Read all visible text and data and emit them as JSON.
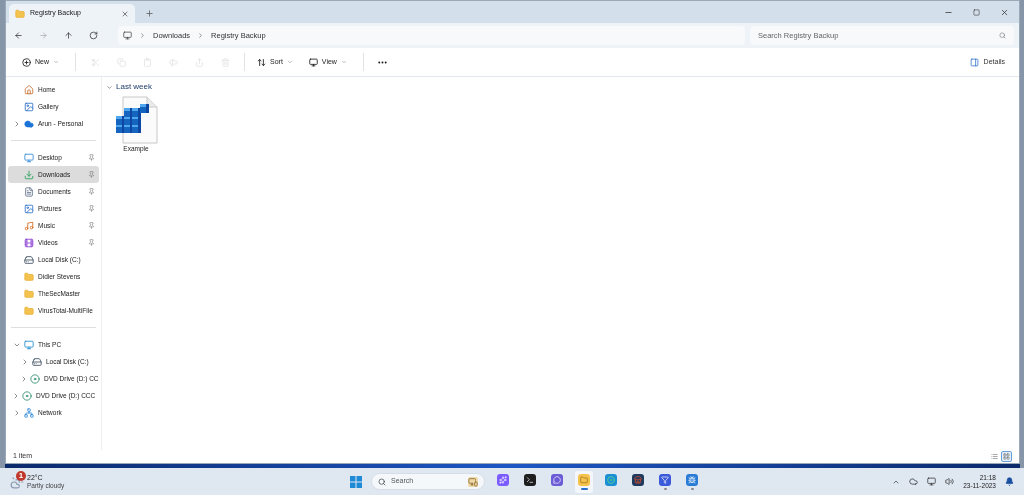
{
  "window": {
    "tabs": [
      {
        "label": "Registry Backup",
        "selected": true
      }
    ]
  },
  "address_bar": {
    "breadcrumb": [
      "Downloads",
      "Registry Backup"
    ],
    "search": {
      "placeholder": "Search Registry Backup"
    }
  },
  "toolbar": {
    "items": [
      {
        "kind": "new",
        "label": "New",
        "disabled": false,
        "dropdown": true
      },
      {
        "kind": "separator"
      },
      {
        "kind": "cut",
        "disabled": true
      },
      {
        "kind": "copy",
        "disabled": true
      },
      {
        "kind": "paste",
        "disabled": true
      },
      {
        "kind": "rename",
        "disabled": true
      },
      {
        "kind": "share",
        "disabled": true
      },
      {
        "kind": "delete",
        "disabled": true
      },
      {
        "kind": "separator"
      },
      {
        "kind": "sort",
        "label": "Sort",
        "disabled": false,
        "dropdown": true
      },
      {
        "kind": "view",
        "label": "View",
        "disabled": false,
        "dropdown": true
      },
      {
        "kind": "separator"
      },
      {
        "kind": "more",
        "disabled": false
      }
    ],
    "details": {
      "label": "Details"
    }
  },
  "sidebar": {
    "sections": [
      {
        "items": [
          {
            "label": "Home",
            "kind": "home",
            "selected": false
          },
          {
            "label": "Gallery",
            "kind": "gallery",
            "selected": false
          },
          {
            "label": "Arun - Personal",
            "kind": "cloud",
            "selected": false,
            "expanded": false
          }
        ]
      },
      {
        "items": [
          {
            "label": "Desktop",
            "kind": "desktop",
            "selected": false,
            "pinned": true
          },
          {
            "label": "Downloads",
            "kind": "download",
            "selected": true,
            "pinned": true
          },
          {
            "label": "Documents",
            "kind": "document",
            "selected": false,
            "pinned": true
          },
          {
            "label": "Pictures",
            "kind": "picture",
            "selected": false,
            "pinned": true
          },
          {
            "label": "Music",
            "kind": "music",
            "selected": false,
            "pinned": true
          },
          {
            "label": "Videos",
            "kind": "video",
            "selected": false,
            "pinned": true
          },
          {
            "label": "Local Disk (C:)",
            "kind": "drive",
            "selected": false
          },
          {
            "label": "Didier Stevens",
            "kind": "folder",
            "selected": false
          },
          {
            "label": "TheSecMaster",
            "kind": "folder",
            "selected": false
          },
          {
            "label": "VirusTotal-MultiFile",
            "kind": "folder",
            "selected": false
          }
        ]
      },
      {
        "items": [
          {
            "label": "This PC",
            "kind": "pc",
            "selected": false,
            "expanded": true,
            "children": [
              {
                "label": "Local Disk (C:)",
                "kind": "drive",
                "selected": false,
                "expanded": false
              },
              {
                "label": "DVD Drive (D:) CC",
                "kind": "dvd",
                "selected": false,
                "expanded": false
              }
            ]
          },
          {
            "label": "DVD Drive (D:) CCC",
            "kind": "dvd",
            "selected": false,
            "expanded": false
          },
          {
            "label": "Network",
            "kind": "network",
            "selected": false,
            "expanded": false
          }
        ]
      }
    ]
  },
  "content": {
    "groups": [
      {
        "label": "Last week",
        "expanded": true,
        "files": [
          {
            "name": "Example",
            "kind": "registry"
          }
        ]
      }
    ]
  },
  "status_bar": {
    "count": "1 item",
    "views": [
      {
        "kind": "details",
        "selected": false
      },
      {
        "kind": "tiles",
        "selected": true
      }
    ]
  },
  "taskbar": {
    "weather": {
      "badge": "1",
      "temperature": "22°C",
      "condition": "Partly cloudy"
    },
    "search": {
      "placeholder": "Search"
    },
    "apps": [
      {
        "kind": "copilot",
        "open": false,
        "selected": false
      },
      {
        "kind": "terminal",
        "open": false,
        "selected": false
      },
      {
        "kind": "chat",
        "open": false,
        "selected": false
      },
      {
        "kind": "explorer",
        "open": true,
        "selected": true
      },
      {
        "kind": "edge",
        "open": false,
        "selected": false
      },
      {
        "kind": "store",
        "open": false,
        "selected": false
      },
      {
        "kind": "funnel",
        "open": true,
        "selected": false
      },
      {
        "kind": "bug",
        "open": true,
        "selected": false
      }
    ],
    "clock": {
      "time": "21:18",
      "date": "23-11-2023"
    }
  }
}
